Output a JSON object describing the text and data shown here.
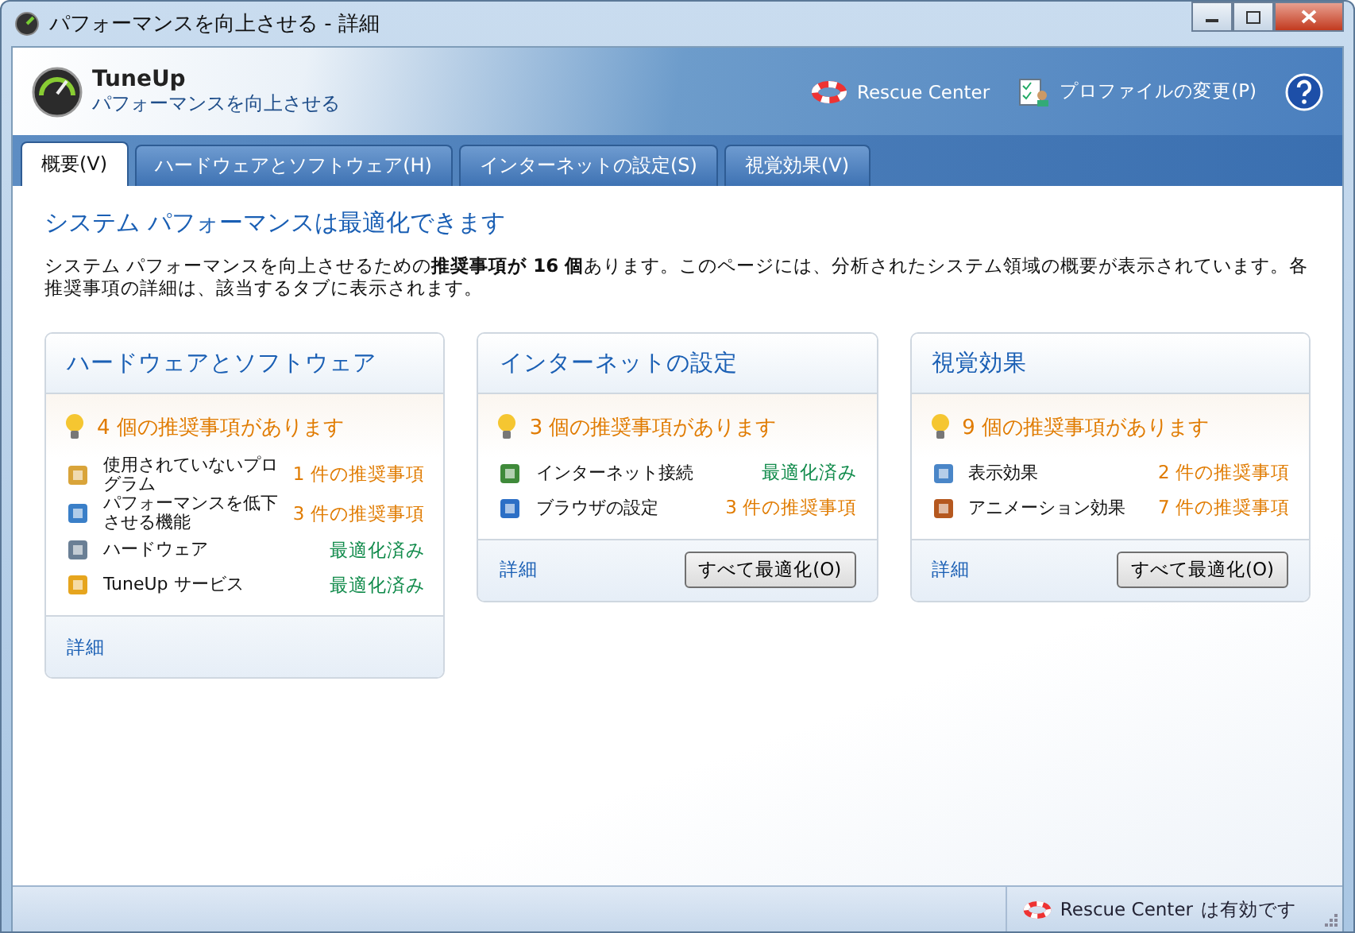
{
  "window": {
    "title": "パフォーマンスを向上させる - 詳細"
  },
  "header": {
    "app_name": "TuneUp",
    "subtitle": "パフォーマンスを向上させる",
    "links": [
      "Rescue Center",
      "プロファイルの変更(P)"
    ]
  },
  "tabs": [
    {
      "label": "概要(V)",
      "selected": true
    },
    {
      "label": "ハードウェアとソフトウェア(H)",
      "selected": false
    },
    {
      "label": "インターネットの設定(S)",
      "selected": false
    },
    {
      "label": "視覚効果(V)",
      "selected": false
    }
  ],
  "heading": "システム パフォーマンスは最適化できます",
  "description": "システム パフォーマンスを向上させるための**推奨事項が 16 個**あります。このページには、分析されたシステム領域の概要が表示されています。各推奨事項の詳細は、該当するタブに表示されます。",
  "cards": [
    {
      "title": "ハードウェアとソフトウェア",
      "summary": "4 個の推奨事項があります",
      "items": [
        {
          "label": "使用されていないプログラム",
          "status": "1 件の推奨事項",
          "kind": "recommendation"
        },
        {
          "label": "パフォーマンスを低下させる機能",
          "status": "3 件の推奨事項",
          "kind": "recommendation"
        },
        {
          "label": "ハードウェア",
          "status": "最適化済み",
          "kind": "optimized"
        },
        {
          "label": "TuneUp サービス",
          "status": "最適化済み",
          "kind": "optimized"
        }
      ],
      "link": "詳細"
    },
    {
      "title": "インターネットの設定",
      "summary": "3 個の推奨事項があります",
      "items": [
        {
          "label": "インターネット接続",
          "status": "最適化済み",
          "kind": "optimized"
        },
        {
          "label": "ブラウザの設定",
          "status": "3 件の推奨事項",
          "kind": "recommendation"
        }
      ],
      "link": "詳細",
      "button": "すべて最適化(O)"
    },
    {
      "title": "視覚効果",
      "summary": "9 個の推奨事項があります",
      "items": [
        {
          "label": "表示効果",
          "status": "2 件の推奨事項",
          "kind": "recommendation"
        },
        {
          "label": "アニメーション効果",
          "status": "7 件の推奨事項",
          "kind": "recommendation"
        }
      ],
      "link": "詳細",
      "button": "すべて最適化(O)"
    }
  ],
  "status_bar": {
    "label": "Rescue Center",
    "text": "は有効です"
  }
}
